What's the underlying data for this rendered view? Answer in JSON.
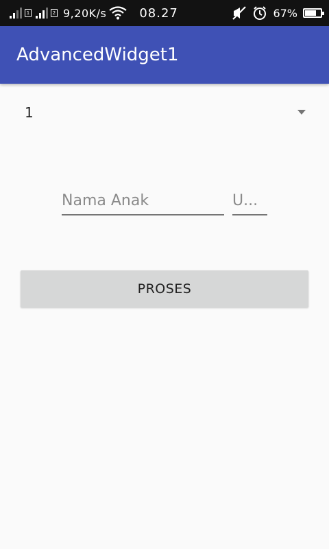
{
  "status_bar": {
    "network_speed": "9,20K/s",
    "time": "08.27",
    "battery_percent": "67%",
    "battery_level": 0.67,
    "sim1_label": "1",
    "sim2_label": "2"
  },
  "app_bar": {
    "title": "AdvancedWidget1",
    "color": "#3f51b5"
  },
  "spinner": {
    "selected_value": "1"
  },
  "form": {
    "nama_placeholder": "Nama Anak",
    "umur_placeholder": "U..."
  },
  "button": {
    "label": "PROSES"
  }
}
